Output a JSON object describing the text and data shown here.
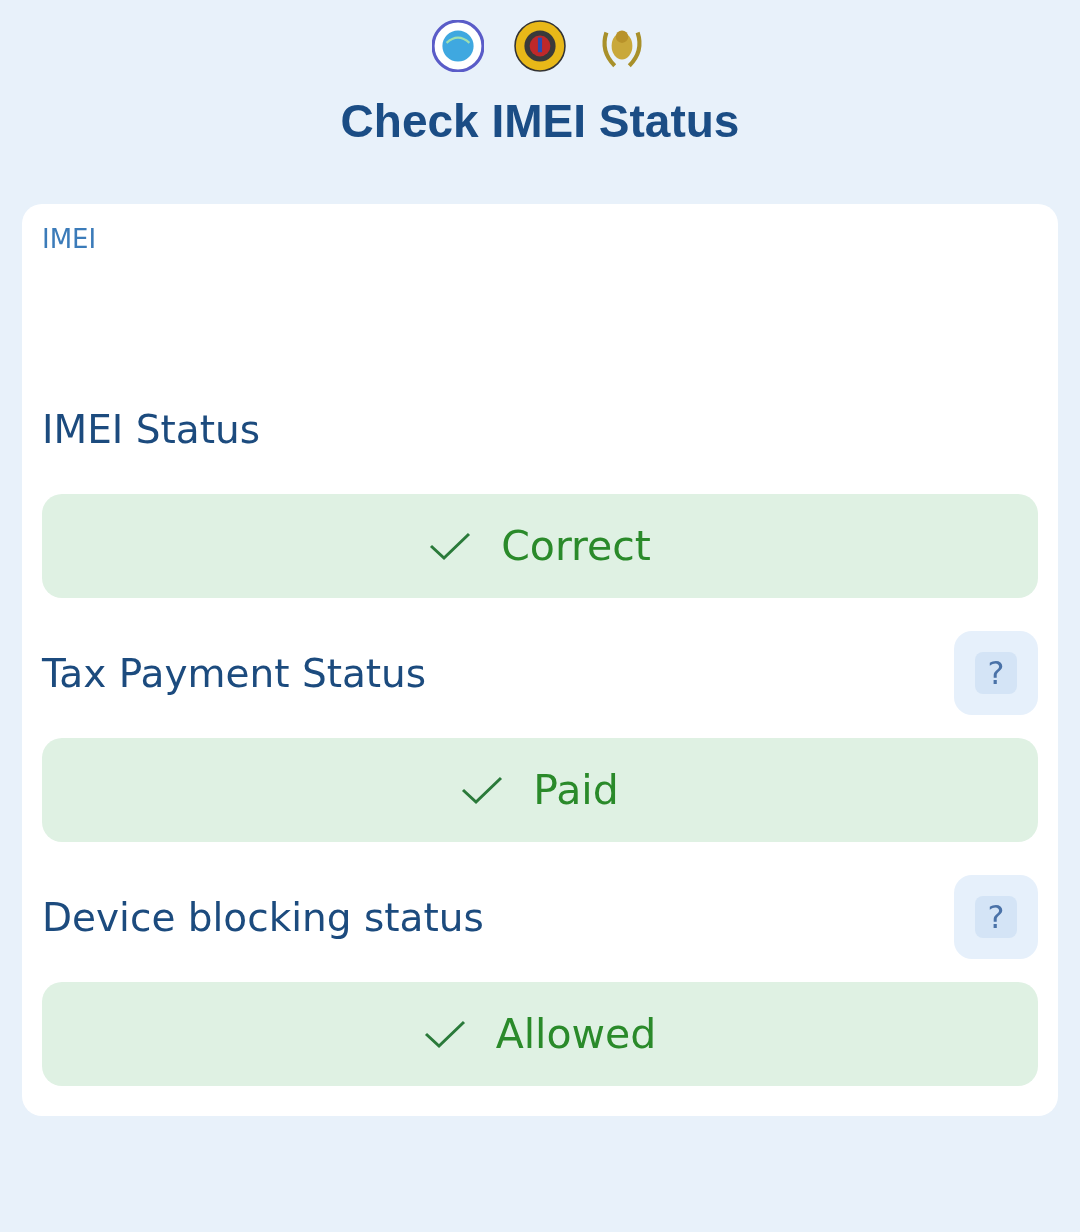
{
  "header": {
    "title": "Check IMEI Status"
  },
  "form": {
    "field_label": "IMEI",
    "sections": [
      {
        "label": "IMEI Status",
        "status": "Correct",
        "kind": "ok"
      },
      {
        "label": "Tax Payment Status",
        "status": "Paid",
        "kind": "ok",
        "help": "?"
      },
      {
        "label": "Device blocking status",
        "status": "Allowed",
        "kind": "ok",
        "help": "?"
      }
    ]
  }
}
